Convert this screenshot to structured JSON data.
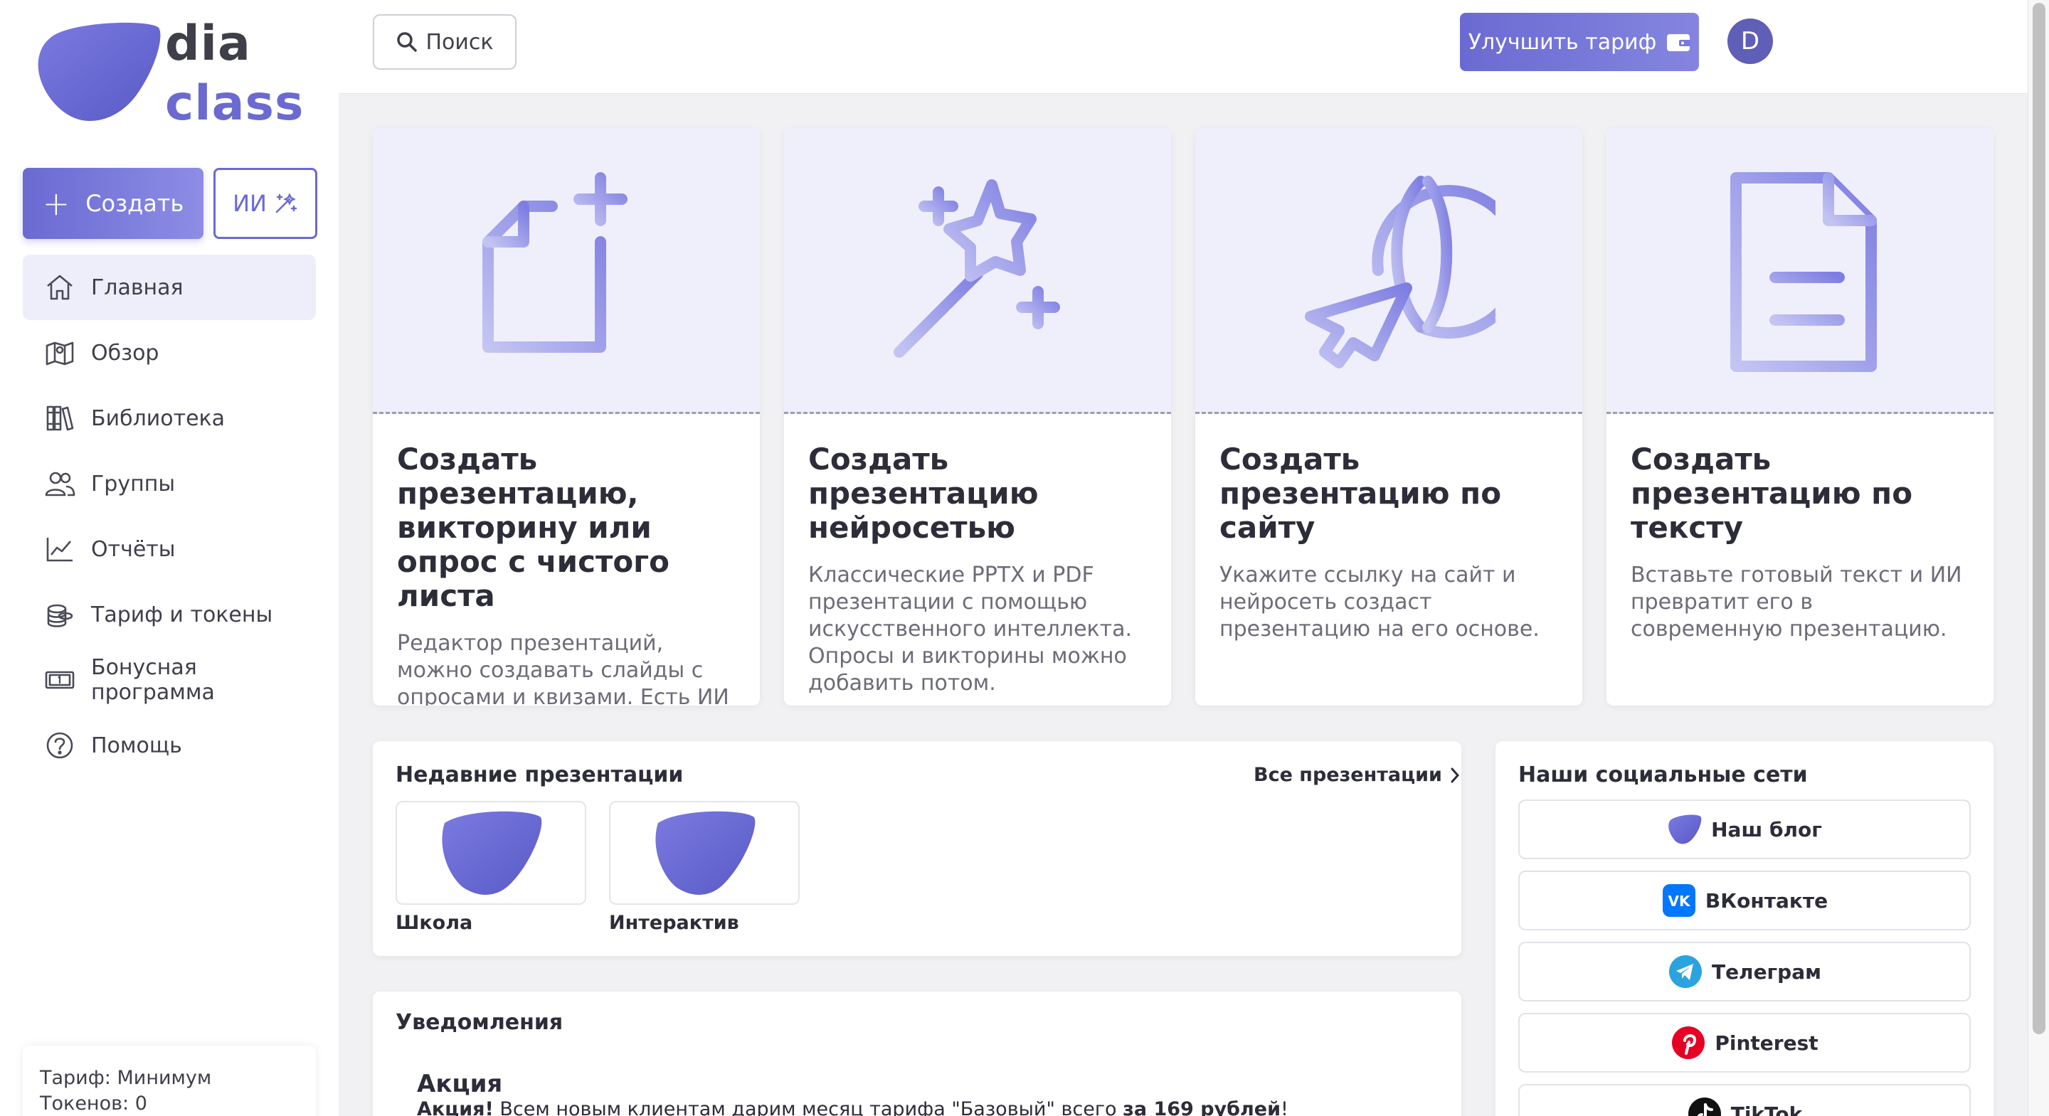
{
  "brand": {
    "line1": "dia",
    "line2": "class"
  },
  "sidebar": {
    "create_label": "Создать",
    "ai_label": "ИИ",
    "items": [
      {
        "label": "Главная",
        "icon": "home-icon",
        "active": true
      },
      {
        "label": "Обзор",
        "icon": "map-icon"
      },
      {
        "label": "Библиотека",
        "icon": "library-icon"
      },
      {
        "label": "Группы",
        "icon": "users-icon"
      },
      {
        "label": "Отчёты",
        "icon": "chart-icon"
      },
      {
        "label": "Тариф и токены",
        "icon": "coins-icon"
      },
      {
        "label": "Бонусная программа",
        "icon": "bonus-icon"
      },
      {
        "label": "Помощь",
        "icon": "help-icon"
      }
    ],
    "tariff_label": "Тариф: Минимум",
    "tokens_label": "Токенов: 0"
  },
  "topbar": {
    "search_label": "Поиск",
    "upgrade_label": "Улучшить тариф",
    "avatar_letter": "D"
  },
  "cards": [
    {
      "title": "Создать презентацию, викторину или опрос с чистого листа",
      "desc": "Редактор презентаций, можно создавать слайды с опросами и квизами. Есть ИИ помощники.",
      "icon": "new-file-icon"
    },
    {
      "title": "Создать презентацию нейросетью",
      "desc": "Классические PPTX и PDF презентации с помощью искусственного интеллекта. Опросы и викторины можно добавить потом.",
      "icon": "magic-wand-icon"
    },
    {
      "title": "Создать презентацию по сайту",
      "desc": "Укажите ссылку на сайт и нейросеть создаст презентацию на его основе.",
      "icon": "globe-cursor-icon"
    },
    {
      "title": "Создать презентацию по тексту",
      "desc": "Вставьте готовый текст и ИИ превратит его в современную презентацию.",
      "icon": "document-icon"
    }
  ],
  "recent": {
    "title": "Недавние презентации",
    "all_link": "Все презентации",
    "items": [
      {
        "label": "Школа"
      },
      {
        "label": "Интерактив"
      }
    ]
  },
  "notifications": {
    "title": "Уведомления",
    "heading": "Акция",
    "text_bold": "Акция!",
    "text_main": " Всем новым клиентам дарим месяц тарифа \"Базовый\" всего ",
    "text_price": "за 169 рублей",
    "text_end": "!"
  },
  "social": {
    "title": "Наши социальные сети",
    "items": [
      {
        "label": "Наш блог",
        "icon": "diaclass-logo-icon"
      },
      {
        "label": "ВКонтакте",
        "icon": "vk-icon"
      },
      {
        "label": "Телеграм",
        "icon": "telegram-icon"
      },
      {
        "label": "Pinterest",
        "icon": "pinterest-icon"
      },
      {
        "label": "TikTok",
        "icon": "tiktok-icon"
      }
    ]
  },
  "colors": {
    "accent": "#6a6ad2",
    "card_art_bg": "#efeffc",
    "icon_gradient_start": "#8a8ae6",
    "icon_gradient_end": "#c2c2f2"
  }
}
